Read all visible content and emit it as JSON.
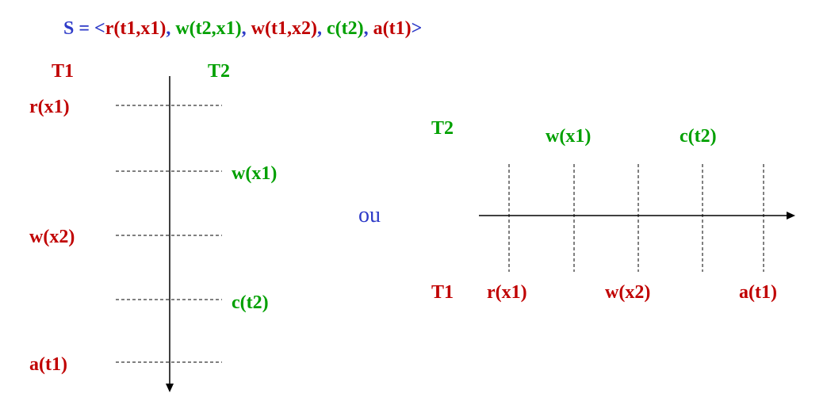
{
  "colors": {
    "t1": "#C00000",
    "t2": "#00A000",
    "syntax": "#2E3BC8",
    "lines": "#000000"
  },
  "title": {
    "prefix": "S = <",
    "ops": [
      {
        "text": "r(t1,x1)",
        "tx": "t1"
      },
      {
        "text": "w(t2,x1)",
        "tx": "t2"
      },
      {
        "text": "w(t1,x2)",
        "tx": "t1"
      },
      {
        "text": "c(t2)",
        "tx": "t2"
      },
      {
        "text": "a(t1)",
        "tx": "t1"
      }
    ],
    "separator": ", ",
    "suffix": ">"
  },
  "vertical": {
    "t1_label": "T1",
    "t2_label": "T2",
    "t1_ops": [
      "r(x1)",
      "w(x2)",
      "a(t1)"
    ],
    "t2_ops": [
      "w(x1)",
      "c(t2)"
    ]
  },
  "or_word": "ou",
  "horizontal": {
    "t1_label": "T1",
    "t2_label": "T2",
    "t1_ops": [
      "r(x1)",
      "w(x2)",
      "a(t1)"
    ],
    "t2_ops": [
      "w(x1)",
      "c(t2)"
    ]
  }
}
